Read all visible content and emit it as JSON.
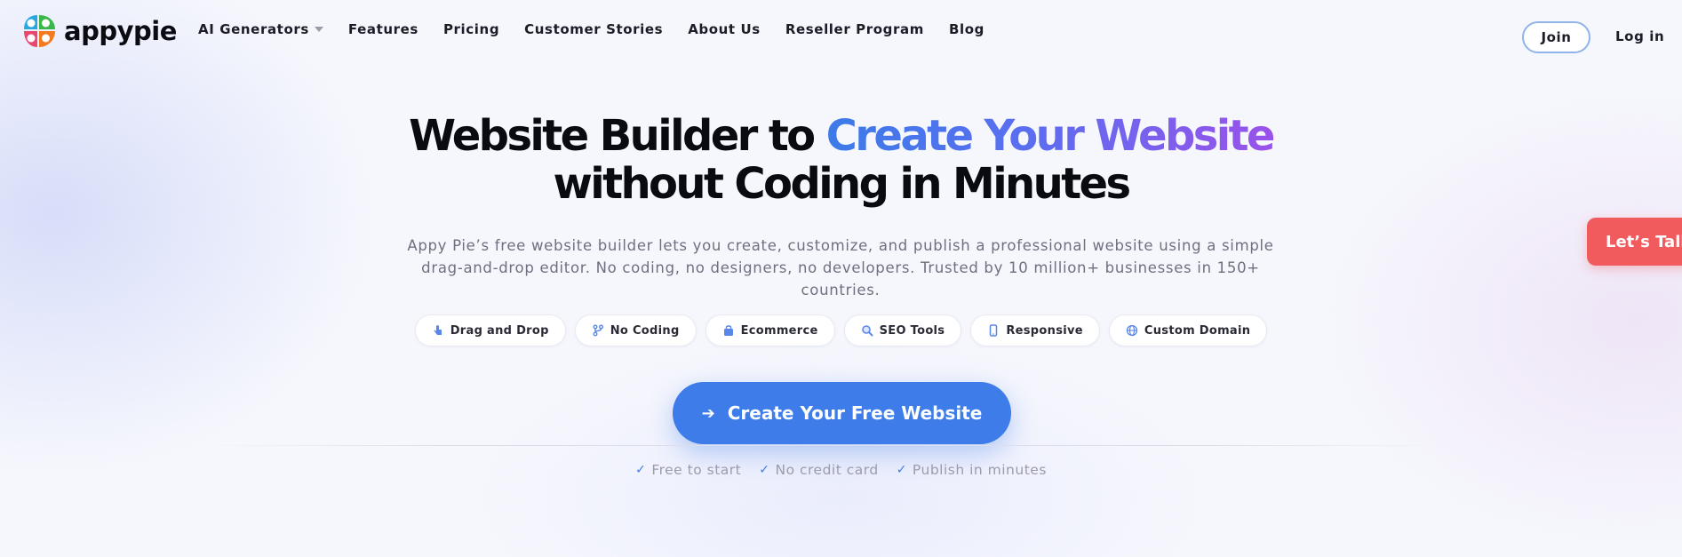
{
  "header": {
    "logo_text": "appypie",
    "nav": [
      {
        "label": "AI Generators"
      },
      {
        "label": "Features"
      },
      {
        "label": "Pricing"
      },
      {
        "label": "Customer Stories"
      },
      {
        "label": "About Us"
      },
      {
        "label": "Reseller Program"
      },
      {
        "label": "Blog"
      }
    ],
    "join_label": "Join",
    "login_label": "Log in"
  },
  "hero": {
    "headline_part1": "Website Builder to ",
    "headline_highlight": "Create Your Website",
    "headline_line2": "without Coding in Minutes",
    "subtext": "Appy Pie’s free website builder lets you create, customize, and publish a professional website using a simple drag-and-drop editor. No coding, no designers, no developers. Trusted by 10 million+ businesses in 150+ countries.",
    "chips": [
      {
        "label": "Drag and Drop",
        "icon": "pointer-hand-icon"
      },
      {
        "label": "No Coding",
        "icon": "code-branch-icon"
      },
      {
        "label": "Ecommerce",
        "icon": "shopping-bag-icon"
      },
      {
        "label": "SEO Tools",
        "icon": "magnifier-icon"
      },
      {
        "label": "Responsive",
        "icon": "mobile-icon"
      },
      {
        "label": "Custom Domain",
        "icon": "globe-icon"
      }
    ],
    "cta_label": "Create Your Free Website",
    "perks": [
      {
        "label": "Free to start"
      },
      {
        "label": "No credit card"
      },
      {
        "label": "Publish in minutes"
      }
    ]
  },
  "floating": {
    "talk_label": "Let’s Talk"
  },
  "colors": {
    "accent": "#3d7ce9",
    "gradient_start": "#3c7be8",
    "gradient_end": "#9a52ea",
    "talk_bg": "#f25b5e"
  }
}
